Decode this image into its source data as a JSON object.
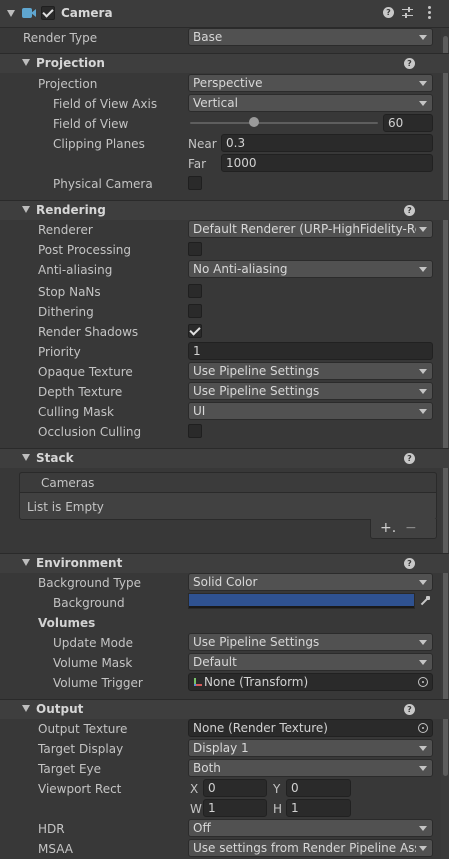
{
  "component": {
    "title": "Camera",
    "enabled": true
  },
  "render_type": {
    "label": "Render Type",
    "value": "Base"
  },
  "projection": {
    "header": "Projection",
    "projection_label": "Projection",
    "projection_value": "Perspective",
    "fov_axis_label": "Field of View Axis",
    "fov_axis_value": "Vertical",
    "fov_label": "Field of View",
    "fov_value": "60",
    "fov_slider_fraction": 0.34,
    "clipping_label": "Clipping Planes",
    "near_label": "Near",
    "near_value": "0.3",
    "far_label": "Far",
    "far_value": "1000",
    "physical_label": "Physical Camera",
    "physical_checked": false
  },
  "rendering": {
    "header": "Rendering",
    "renderer_label": "Renderer",
    "renderer_value": "Default Renderer (URP-HighFidelity-Rer",
    "post_label": "Post Processing",
    "aa_label": "Anti-aliasing",
    "aa_value": "No Anti-aliasing",
    "nans_label": "Stop NaNs",
    "dither_label": "Dithering",
    "shadows_label": "Render Shadows",
    "shadows_checked": true,
    "priority_label": "Priority",
    "priority_value": "1",
    "opaque_label": "Opaque Texture",
    "opaque_value": "Use Pipeline Settings",
    "depth_label": "Depth Texture",
    "depth_value": "Use Pipeline Settings",
    "culling_label": "Culling Mask",
    "culling_value": "UI",
    "occlusion_label": "Occlusion Culling"
  },
  "stack": {
    "header": "Stack",
    "list_title": "Cameras",
    "empty_text": "List is Empty",
    "add_glyph": "+.",
    "remove_glyph": "−"
  },
  "environment": {
    "header": "Environment",
    "bg_type_label": "Background Type",
    "bg_type_value": "Solid Color",
    "bg_label": "Background",
    "bg_color": "#2f5291",
    "volumes_label": "Volumes",
    "update_label": "Update Mode",
    "update_value": "Use Pipeline Settings",
    "mask_label": "Volume Mask",
    "mask_value": "Default",
    "trigger_label": "Volume Trigger",
    "trigger_value": "None (Transform)"
  },
  "output": {
    "header": "Output",
    "tex_label": "Output Texture",
    "tex_value": "None (Render Texture)",
    "display_label": "Target Display",
    "display_value": "Display 1",
    "eye_label": "Target Eye",
    "eye_value": "Both",
    "viewport_label": "Viewport Rect",
    "x_label": "X",
    "x_value": "0",
    "y_label": "Y",
    "y_value": "0",
    "w_label": "W",
    "w_value": "1",
    "h_label": "H",
    "h_value": "1",
    "hdr_label": "HDR",
    "hdr_value": "Off",
    "msaa_label": "MSAA",
    "msaa_value": "Use settings from Render Pipeline Asset"
  },
  "help_glyph": "?",
  "colors": {
    "accent": "#2f5291",
    "panel": "#383838",
    "header": "#3e3e3e"
  }
}
